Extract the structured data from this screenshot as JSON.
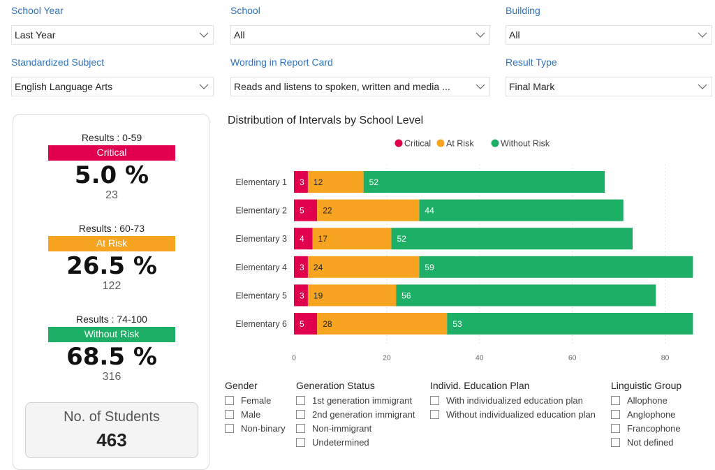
{
  "filters": [
    {
      "label": "School Year",
      "value": "Last Year"
    },
    {
      "label": "School",
      "value": "All"
    },
    {
      "label": "Building",
      "value": "All"
    },
    {
      "label": "Standardized Subject",
      "value": "English Language Arts"
    },
    {
      "label": "Wording in Report Card",
      "value": "Reads and listens to spoken, written and media ..."
    },
    {
      "label": "Result Type",
      "value": "Final Mark"
    }
  ],
  "kpis": [
    {
      "range": "Results : 0-59",
      "badge": "Critical",
      "pct": "5.0 %",
      "count": "23",
      "color": "#e0004d"
    },
    {
      "range": "Results : 60-73",
      "badge": "At Risk",
      "pct": "26.5 %",
      "count": "122",
      "color": "#f7a521"
    },
    {
      "range": "Results : 74-100",
      "badge": "Without Risk",
      "pct": "68.5 %",
      "count": "316",
      "color": "#1eaf67"
    }
  ],
  "students": {
    "label": "No. of Students",
    "value": "463"
  },
  "chart_data": {
    "type": "bar",
    "orientation": "horizontal",
    "stacked": true,
    "title": "Distribution of Intervals by School Level",
    "categories": [
      "Elementary 1",
      "Elementary 2",
      "Elementary 3",
      "Elementary 4",
      "Elementary 5",
      "Elementary 6"
    ],
    "series": [
      {
        "name": "Critical",
        "color": "#e0004d",
        "values": [
          3,
          5,
          4,
          3,
          3,
          5
        ]
      },
      {
        "name": "At Risk",
        "color": "#f7a521",
        "values": [
          12,
          22,
          17,
          24,
          19,
          28
        ]
      },
      {
        "name": "Without Risk",
        "color": "#1eaf67",
        "values": [
          52,
          44,
          52,
          59,
          56,
          53
        ]
      }
    ],
    "xlim": [
      0,
      90
    ],
    "xticks": [
      0,
      20,
      40,
      60,
      80
    ],
    "grid": true,
    "legend": "top-center"
  },
  "slicers": [
    {
      "title": "Gender",
      "items": [
        "Female",
        "Male",
        "Non-binary"
      ]
    },
    {
      "title": "Generation Status",
      "items": [
        "1st generation immigrant",
        "2nd generation immigrant",
        "Non-immigrant",
        "Undetermined"
      ]
    },
    {
      "title": "Individ. Education Plan",
      "items": [
        "With individualized education plan",
        "Without individualized education plan"
      ]
    },
    {
      "title": "Linguistic Group",
      "items": [
        "Allophone",
        "Anglophone",
        "Francophone",
        "Not defined"
      ]
    }
  ]
}
